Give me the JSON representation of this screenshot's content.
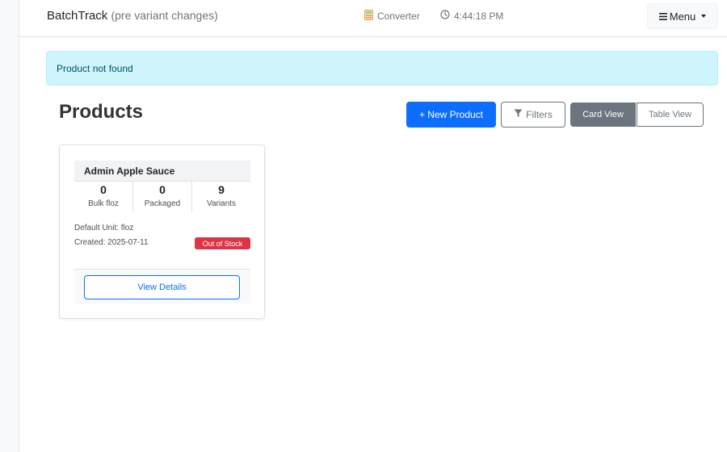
{
  "navbar": {
    "brand": "BatchTrack",
    "brand_sub": "(pre variant changes)",
    "converter_label": "Converter",
    "converter_icon": "calculator-icon",
    "clock_icon": "clock-icon",
    "time": "4:44:18 PM",
    "menu_label": "Menu",
    "menu_icon": "hamburger-icon"
  },
  "alert": {
    "text": "Product not found"
  },
  "page": {
    "title": "Products"
  },
  "toolbar": {
    "new_product_label": "+ New Product",
    "filters_label": "Filters",
    "filters_icon": "funnel-icon",
    "card_view_label": "Card View",
    "table_view_label": "Table View",
    "active_view": "Card View"
  },
  "products": [
    {
      "name": "Admin Apple Sauce",
      "stats": [
        {
          "value": "0",
          "label": "Bulk floz"
        },
        {
          "value": "0",
          "label": "Packaged"
        },
        {
          "value": "9",
          "label": "Variants"
        }
      ],
      "default_unit": "Default Unit: floz",
      "created": "Created: 2025-07-11",
      "status_badge": "Out of Stock",
      "details_label": "View Details"
    }
  ],
  "colors": {
    "primary": "#0d6efd",
    "secondary": "#6c757d",
    "danger": "#dc3545",
    "alert_bg": "#cff4fc",
    "alert_text": "#055160"
  }
}
